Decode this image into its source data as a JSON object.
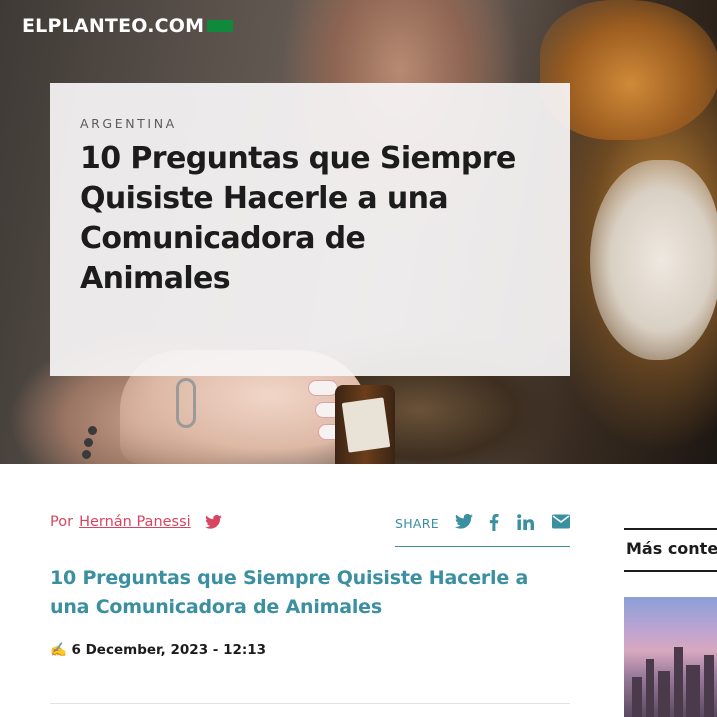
{
  "site": {
    "logo_text": "ELPLANTEO.COM"
  },
  "hero": {
    "category": "ARGENTINA",
    "title": "10 Preguntas que Siempre Quisiste Hacerle a una Comunicadora de Animales"
  },
  "byline": {
    "prefix": "Por",
    "author": "Hernán Panessi"
  },
  "share": {
    "label": "SHARE",
    "icons": [
      "twitter-icon",
      "facebook-icon",
      "linkedin-icon",
      "email-icon"
    ]
  },
  "article": {
    "title": "10 Preguntas que Siempre Quisiste Hacerle a una Comunicadora de Animales",
    "date_line": "✍️ 6 December, 2023 - 12:13"
  },
  "sidebar": {
    "heading": "Más contenido"
  },
  "colors": {
    "accent_teal": "#3a8fa0",
    "accent_pink": "#d84560",
    "flag_green": "#0f8a3c"
  }
}
